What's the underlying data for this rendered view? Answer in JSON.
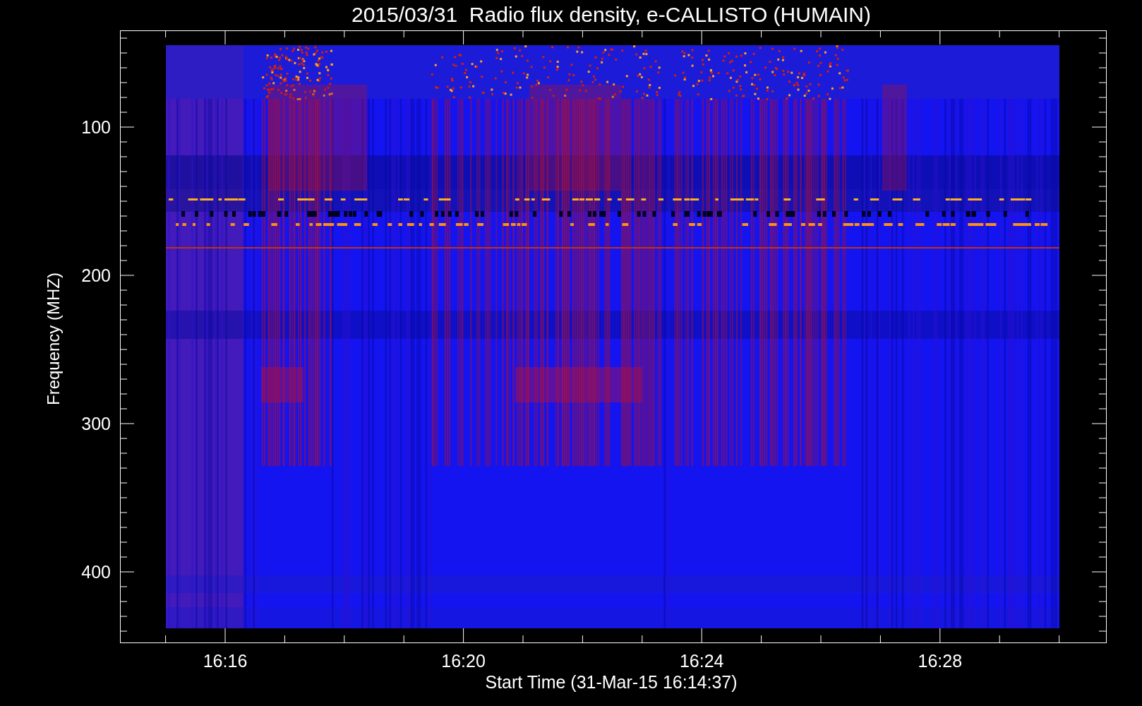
{
  "title": "2015/03/31  Radio flux density, e-CALLISTO (HUMAIN)",
  "y_axis": {
    "label": "Frequency (MHZ)",
    "ticks": [
      "100",
      "200",
      "300",
      "400"
    ]
  },
  "x_axis": {
    "label": "Start Time (31-Mar-15 16:14:37)",
    "ticks": [
      "16:16",
      "16:20",
      "16:24",
      "16:28"
    ]
  }
}
